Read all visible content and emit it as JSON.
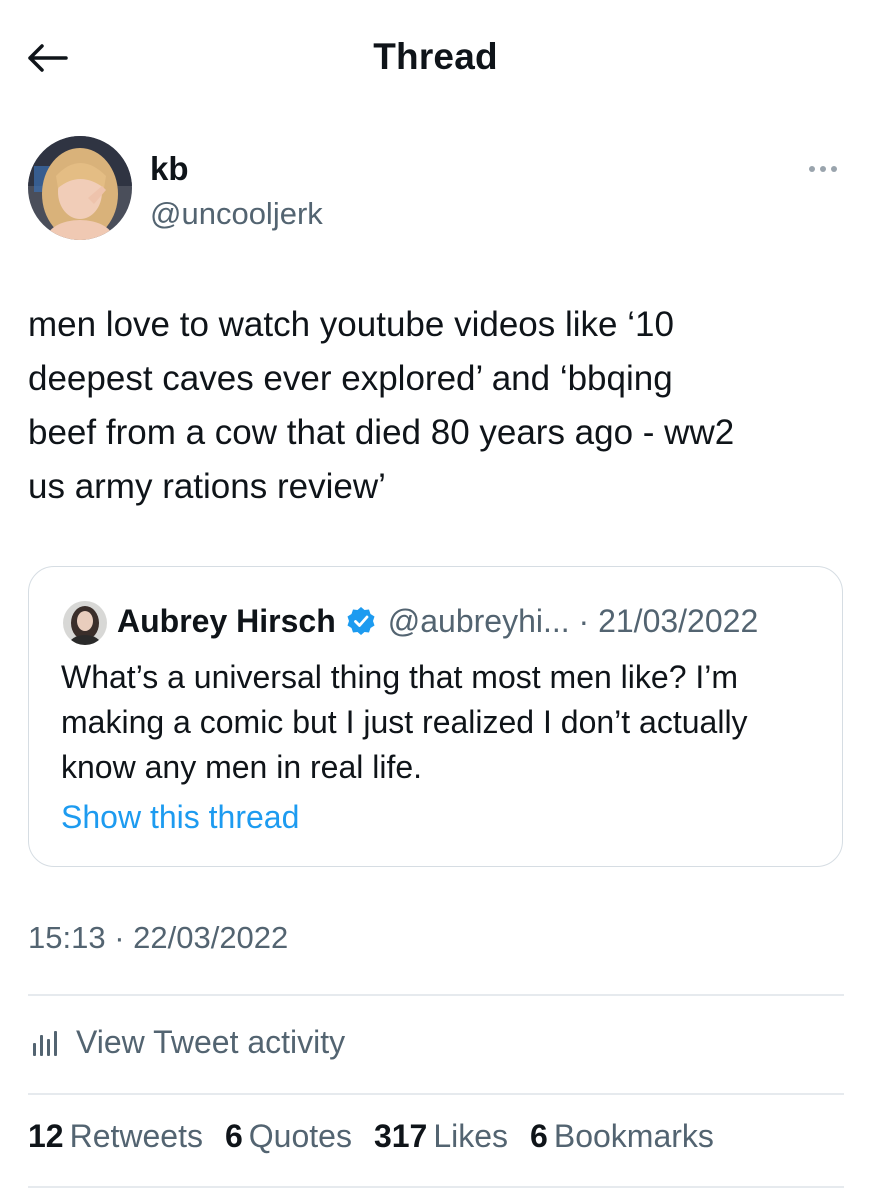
{
  "header": {
    "title": "Thread"
  },
  "author": {
    "name": "kb",
    "handle": "@uncooljerk"
  },
  "tweet": {
    "text": "men love to watch youtube videos like ‘10\ndeepest caves ever explored’ and ‘bbqing\nbeef from a cow that died 80 years ago - ww2\nus army rations review’",
    "timestamp": "15:13 · 22/03/2022"
  },
  "quote": {
    "name": "Aubrey Hirsch",
    "handle_date": "@aubreyhi... · 21/03/2022",
    "text": "What’s a universal thing that most men like? I’m making a comic but I just realized I don’t actually know any men in real life.",
    "link": "Show this thread"
  },
  "activity": {
    "label": "View Tweet activity"
  },
  "stats": [
    {
      "count": "12",
      "label": "Retweets"
    },
    {
      "count": "6",
      "label": "Quotes"
    },
    {
      "count": "317",
      "label": "Likes"
    },
    {
      "count": "6",
      "label": "Bookmarks"
    }
  ],
  "colors": {
    "link": "#1d9bf0",
    "secondary_text": "#536471",
    "verified": "#1d9bf0"
  }
}
